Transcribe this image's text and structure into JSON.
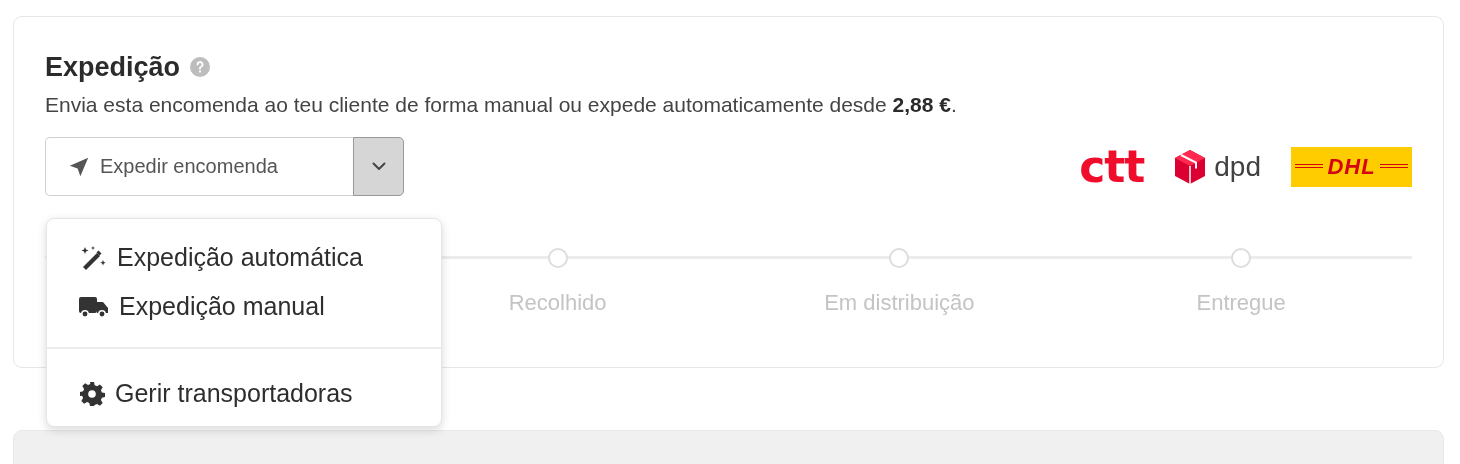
{
  "section": {
    "title": "Expedição",
    "description": "Envia esta encomenda ao teu cliente de forma manual ou expede automaticamente desde **2,88 €**."
  },
  "ship_button": {
    "label": "Expedir encomenda",
    "menu_open": true
  },
  "carriers": [
    {
      "kind": "ctt",
      "name": "ctt"
    },
    {
      "kind": "dpd",
      "name": "dpd"
    },
    {
      "kind": "dhl",
      "name": "DHL"
    }
  ],
  "steps": [
    {
      "label": "Recolhido"
    },
    {
      "label": "Em distribuição"
    },
    {
      "label": "Entregue"
    }
  ],
  "menu": [
    {
      "kind": "wand",
      "label": "Expedição automática"
    },
    {
      "kind": "truck",
      "label": "Expedição manual"
    },
    {
      "kind": "gear",
      "label": "Gerir transportadoras",
      "separated": true
    }
  ]
}
